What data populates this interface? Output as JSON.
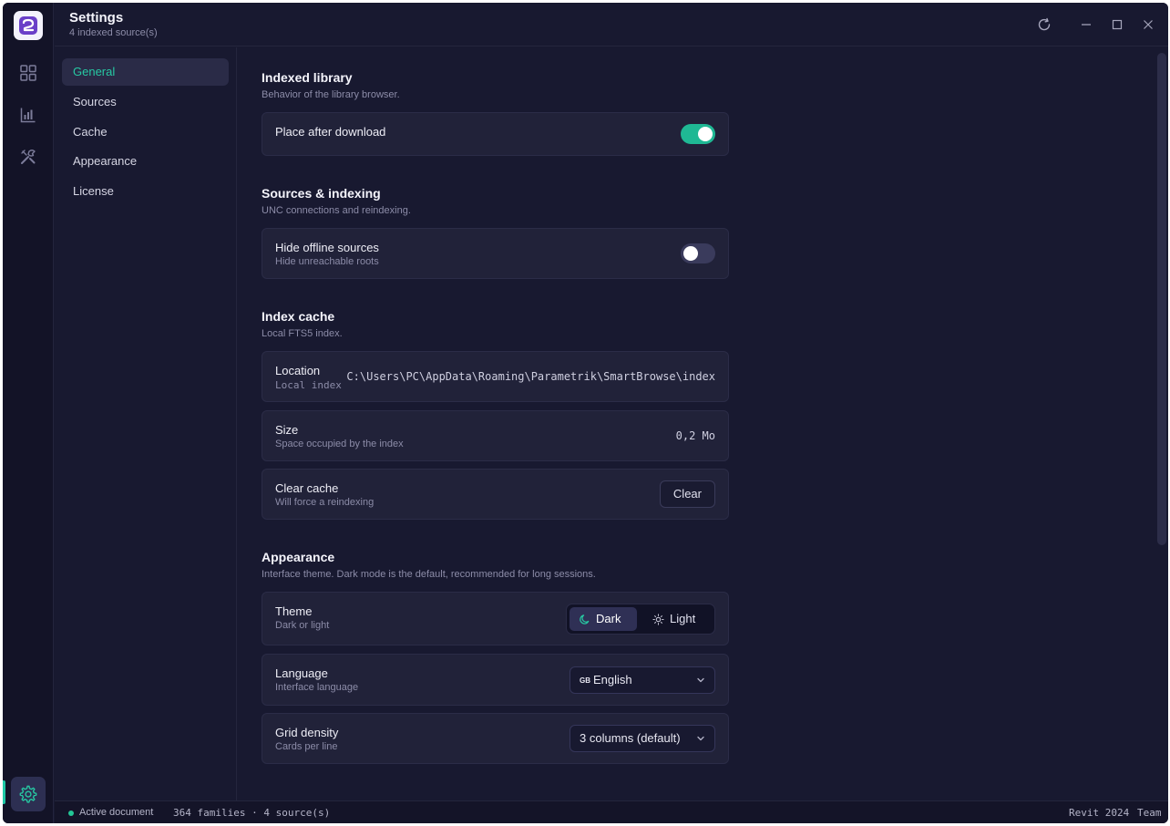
{
  "titlebar": {
    "title": "Settings",
    "subtitle": "4 indexed source(s)"
  },
  "rail": {
    "items": [
      "grid-icon",
      "chart-icon",
      "tools-icon"
    ],
    "bottom_item": "settings-icon"
  },
  "nav": {
    "items": [
      {
        "label": "General"
      },
      {
        "label": "Sources"
      },
      {
        "label": "Cache"
      },
      {
        "label": "Appearance"
      },
      {
        "label": "License"
      }
    ]
  },
  "sections": {
    "indexed": {
      "title": "Indexed library",
      "desc": "Behavior of the library browser.",
      "place_after_download": {
        "label": "Place after download",
        "enabled": true
      }
    },
    "sources": {
      "title": "Sources & indexing",
      "desc": "UNC connections and reindexing.",
      "hide_offline": {
        "label": "Hide offline sources",
        "hint": "Hide unreachable roots",
        "enabled": false
      }
    },
    "cache": {
      "title": "Index cache",
      "desc": "Local FTS5 index.",
      "location": {
        "label": "Location",
        "hint": "Local index",
        "value": "C:\\Users\\PC\\AppData\\Roaming\\Parametrik\\SmartBrowse\\index"
      },
      "size": {
        "label": "Size",
        "hint": "Space occupied by the index",
        "value": "0,2 Mo"
      },
      "clear": {
        "label": "Clear cache",
        "hint": "Will force a reindexing",
        "button": "Clear"
      }
    },
    "appearance": {
      "title": "Appearance",
      "desc": "Interface theme. Dark mode is the default, recommended for long sessions.",
      "theme": {
        "label": "Theme",
        "hint": "Dark or light",
        "options": [
          "Dark",
          "Light"
        ],
        "selected": "Dark"
      },
      "language": {
        "label": "Language",
        "hint": "Interface language",
        "flag": "GB",
        "value": "English"
      },
      "density": {
        "label": "Grid density",
        "hint": "Cards per line",
        "value": "3 columns (default)"
      }
    }
  },
  "statusbar": {
    "active": "Active document",
    "counts": "364 families · 4 source(s)",
    "version": "Revit 2024",
    "plan": "Team"
  },
  "colors": {
    "accent": "#1ec9a6",
    "background": "#181930",
    "card": "#212239"
  }
}
